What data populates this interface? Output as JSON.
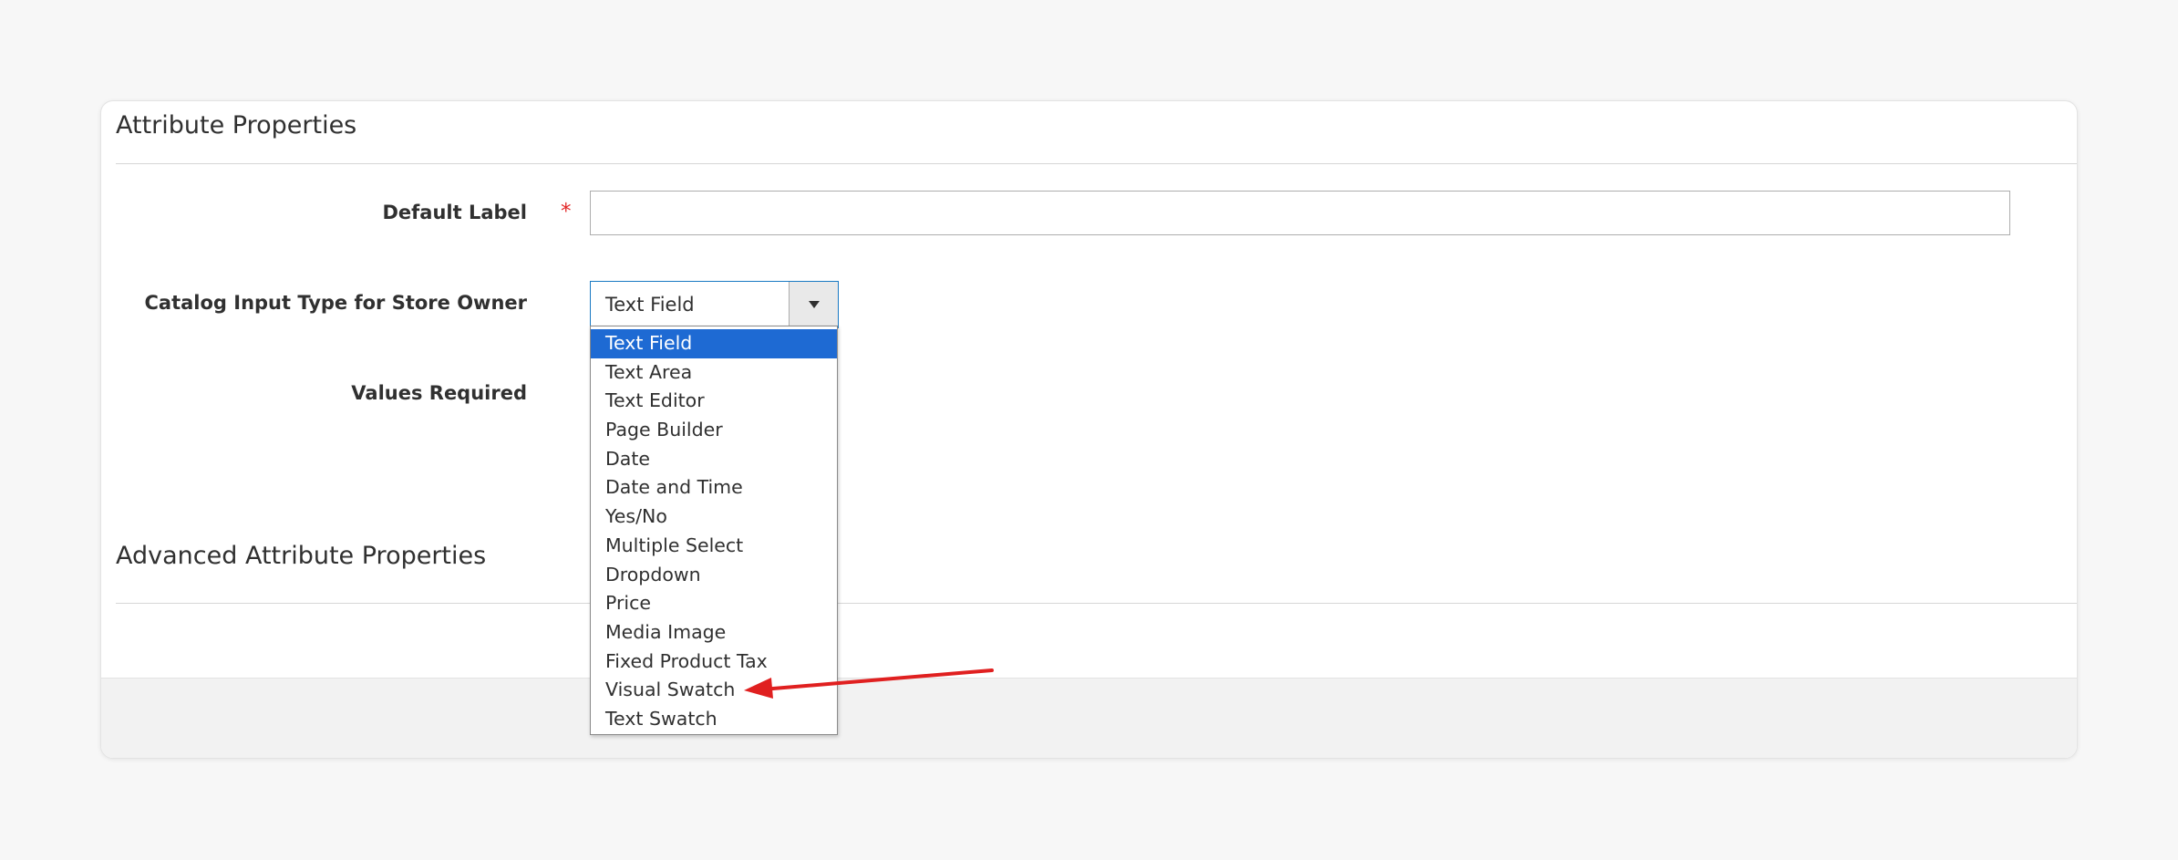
{
  "attribute_properties": {
    "title": "Attribute Properties",
    "default_label": {
      "label": "Default Label",
      "required_mark": "*",
      "value": ""
    },
    "catalog_input_type": {
      "label": "Catalog Input Type for Store Owner",
      "selected": "Text Field",
      "options": [
        "Text Field",
        "Text Area",
        "Text Editor",
        "Page Builder",
        "Date",
        "Date and Time",
        "Yes/No",
        "Multiple Select",
        "Dropdown",
        "Price",
        "Media Image",
        "Fixed Product Tax",
        "Visual Swatch",
        "Text Swatch"
      ]
    },
    "values_required": {
      "label": "Values Required"
    }
  },
  "advanced_attribute_properties": {
    "title": "Advanced Attribute Properties"
  },
  "colors": {
    "selected_option_bg": "#1e6ad3",
    "focus_border": "#1979c3",
    "required_star": "#e22626",
    "annotation_arrow": "#e02020"
  },
  "annotation": {
    "points_to": "Visual Swatch",
    "icon": "red-arrow-icon"
  }
}
